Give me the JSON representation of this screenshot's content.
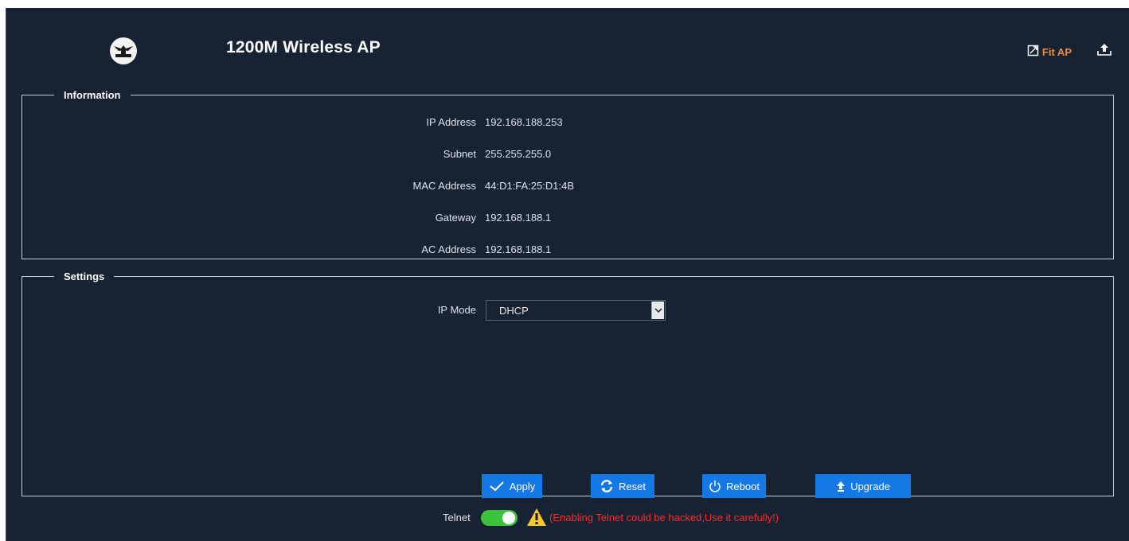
{
  "header": {
    "title": "1200M Wireless AP",
    "fit_ap_label": "Fit AP",
    "accent": "#f08a3c"
  },
  "information": {
    "legend": "Information",
    "rows": [
      {
        "label": "IP Address",
        "value": "192.168.188.253"
      },
      {
        "label": "Subnet",
        "value": "255.255.255.0"
      },
      {
        "label": "MAC Address",
        "value": "44:D1:FA:25:D1:4B"
      },
      {
        "label": "Gateway",
        "value": "192.168.188.1"
      },
      {
        "label": "AC Address",
        "value": "192.168.188.1"
      }
    ]
  },
  "settings": {
    "legend": "Settings",
    "ip_mode_label": "IP Mode",
    "ip_mode_value": "DHCP",
    "buttons": {
      "apply": "Apply",
      "reset": "Reset",
      "reboot": "Reboot",
      "upgrade": "Upgrade"
    },
    "button_color": "#1478e6"
  },
  "telnet": {
    "label": "Telnet",
    "enabled": true,
    "warning": "(Enabling Telnet could be hacked,Use it carefully!)",
    "toggle_color": "#3cc23c",
    "warning_color": "#ff2a2a"
  },
  "icons": [
    "brand-logo-icon",
    "fit-ap-icon",
    "upload-icon",
    "chevron-down-icon",
    "check-icon",
    "refresh-icon",
    "power-icon",
    "arrow-up-icon",
    "warning-icon"
  ]
}
